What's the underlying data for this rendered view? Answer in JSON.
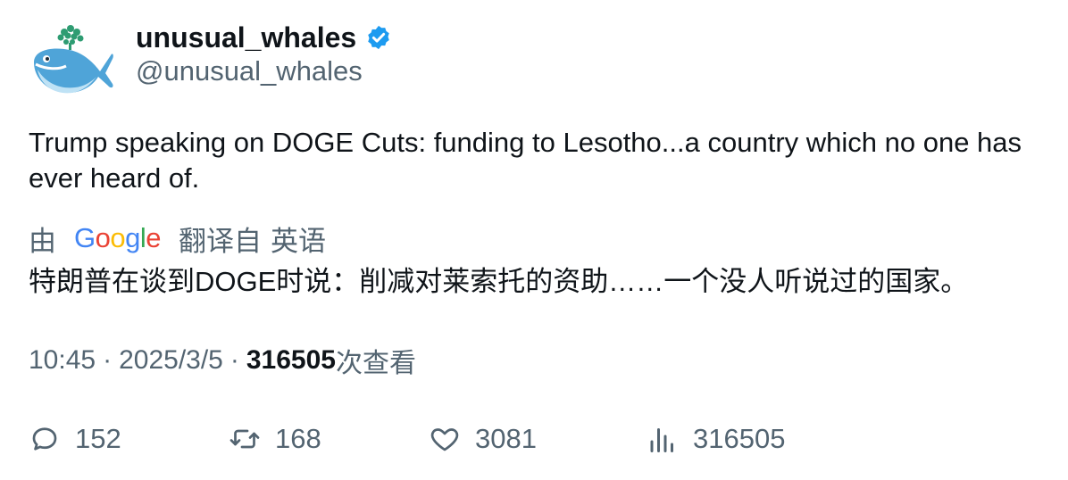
{
  "author": {
    "display_name": "unusual_whales",
    "handle": "@unusual_whales",
    "verified": true,
    "avatar_icon": "whale-logo-icon"
  },
  "tweet": {
    "text": "Trump speaking on DOGE Cuts: funding to Lesotho...a country which no one has ever heard of."
  },
  "translation": {
    "by_label": "由",
    "provider_letters": [
      "G",
      "o",
      "o",
      "g",
      "l",
      "e"
    ],
    "from_label": "翻译自",
    "language": "英语",
    "translated_text": "特朗普在谈到DOGE时说：削减对莱索托的资助……一个没人听说过的国家。"
  },
  "meta": {
    "time": "10:45",
    "separator": "·",
    "date": "2025/3/5",
    "views_count": "316505",
    "views_label": "次查看"
  },
  "actions": {
    "replies": "152",
    "retweets": "168",
    "likes": "3081",
    "views": "316505"
  },
  "colors": {
    "text_primary": "#0f1419",
    "text_secondary": "#536471",
    "verified_blue": "#1d9bf0",
    "whale_blue": "#4fa4d8",
    "spout_green": "#2e9c72"
  }
}
